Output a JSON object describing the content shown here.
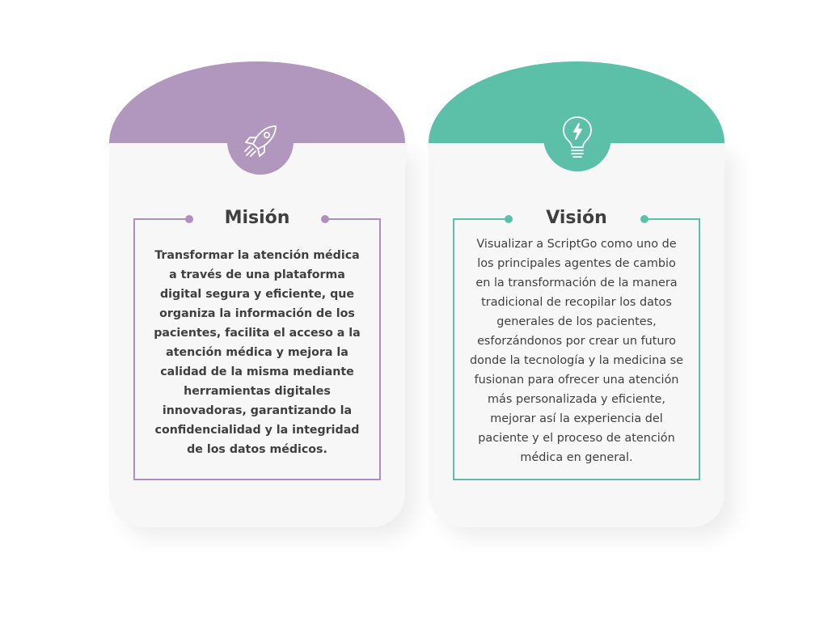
{
  "cards": {
    "mision": {
      "title": "Misión",
      "icon": "rocket-icon",
      "color": "#b196bd",
      "text": "Transformar la atención médica\na través de una plataforma\ndigital segura y eficiente, que\norganiza la información de los\npacientes, facilita el acceso a la\natención médica y mejora la\ncalidad de la misma mediante\nherramientas digitales\ninnovadoras, garantizando la\nconfidencialidad y la integridad\nde los datos médicos."
    },
    "vision": {
      "title": "Visión",
      "icon": "lightbulb-icon",
      "color": "#5cc0a8",
      "text": "Visualizar a ScriptGo como uno de\nlos principales agentes de cambio\nen la transformación de la manera\ntradicional de recopilar los datos\ngenerales de los pacientes,\nesforzándonos por crear un futuro\ndonde la tecnología y la medicina se\nfusionan para ofrecer una atención\nmás personalizada y eficiente,\nmejorar así la experiencia del\npaciente y el proceso de atención\nmédica en general."
    }
  }
}
